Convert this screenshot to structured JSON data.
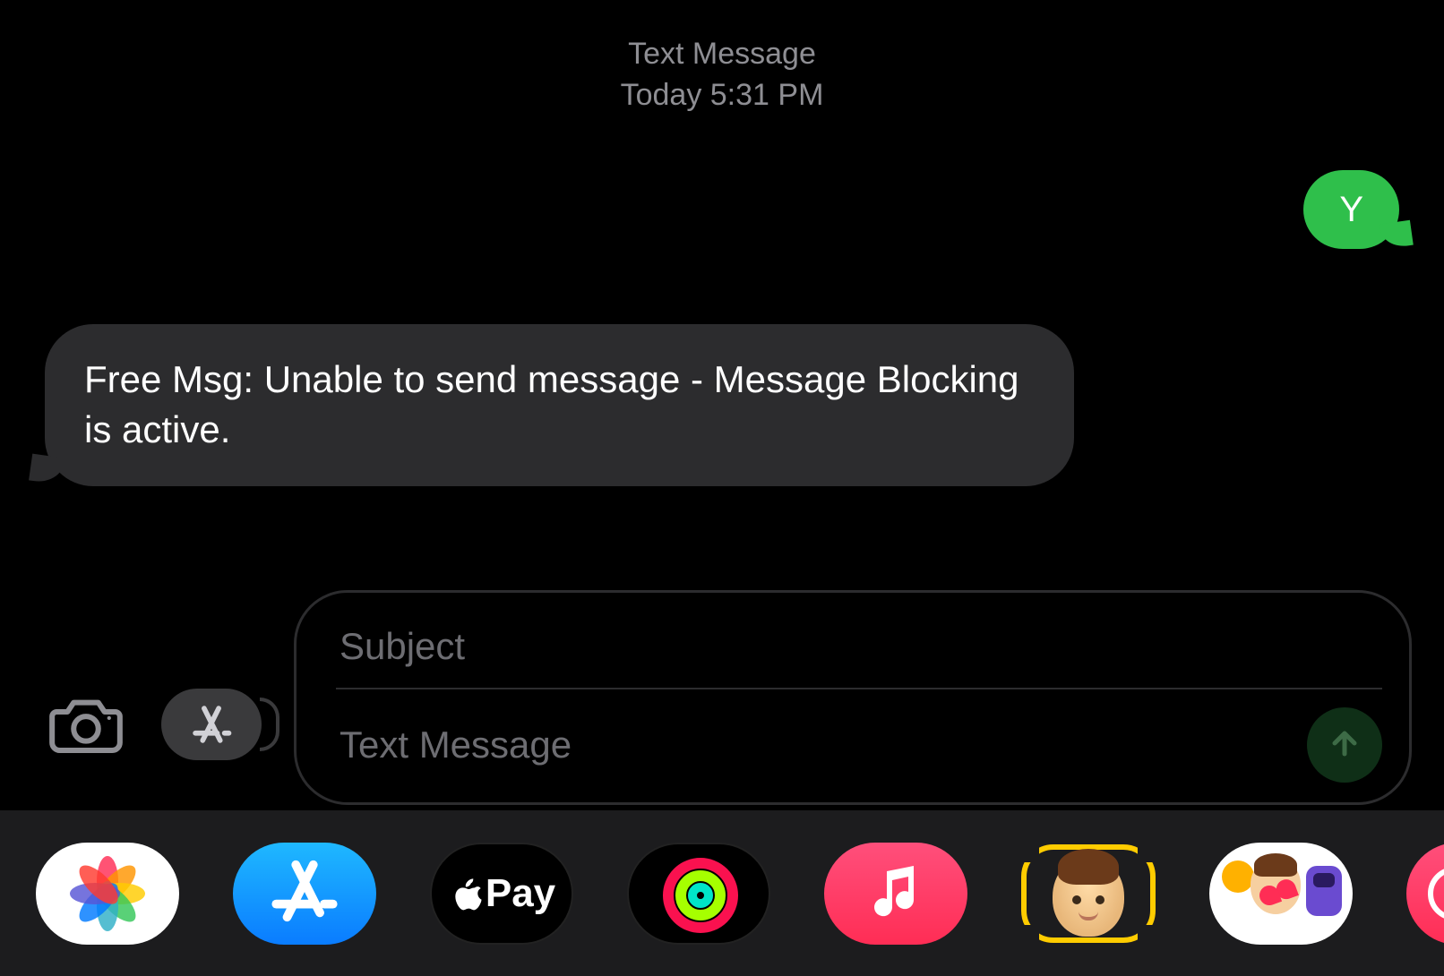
{
  "header": {
    "type_label": "Text Message",
    "timestamp": "Today 5:31 PM"
  },
  "messages": {
    "outgoing_1": "Y",
    "incoming_1": " Free Msg: Unable to send message - Message Blocking is active."
  },
  "compose": {
    "subject_placeholder": "Subject",
    "body_placeholder": "Text Message"
  },
  "toolbar": {
    "camera_name": "camera-icon",
    "apps_name": "imessage-apps-icon",
    "send_name": "send-up-arrow-icon"
  },
  "tray": {
    "photos": "photos-app",
    "appstore": "app-store-app",
    "applepay_label": "Pay",
    "activity": "activity-app",
    "music": "music-app",
    "memoji1": "animoji-app",
    "memoji2": "memoji-stickers-app",
    "partial": "next-app"
  },
  "colors": {
    "sms_green": "#2fbf4b",
    "incoming_gray": "#2c2c2e",
    "placeholder": "#6d6d72",
    "timestamp": "#8e8e93"
  }
}
